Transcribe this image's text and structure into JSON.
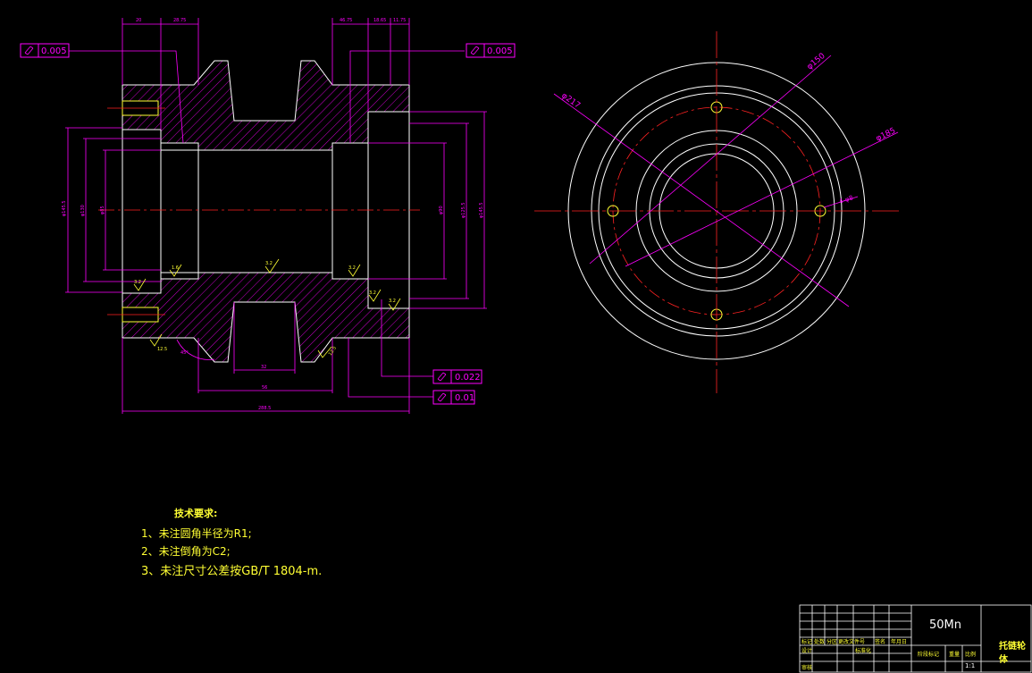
{
  "tolerances": {
    "top_left": "0.005",
    "top_right": "0.005",
    "bottom_1": "0.022",
    "bottom_2": "0.01"
  },
  "roughness": {
    "r1": "1.6",
    "r2": "3.2",
    "r3": "3.2",
    "r4": "3.2",
    "r5": "3.2",
    "r6": "3.2",
    "r7": "12.5",
    "r8": "12.5"
  },
  "dimensions_front": {
    "top_1": "20",
    "top_2": "28.75",
    "top_3": "46.75",
    "top_4": "18.65",
    "top_5": "11.75",
    "bottom_1": "32",
    "bottom_2": "56",
    "bottom_3": "288.5",
    "left_1": "φ145.5",
    "left_2": "φ130",
    "left_3": "φ85",
    "right_1": "φ90",
    "right_2": "φ125.5",
    "right_3": "φ145.5",
    "angle": "45°"
  },
  "dimensions_side": {
    "d1": "φ150",
    "d2": "φ217",
    "d3": "φ185",
    "hole": "4-φ8"
  },
  "tech_notes": {
    "title": "技术要求:",
    "n1": "1、未注圆角半径为R1;",
    "n2": "2、未注倒角为C2;",
    "n3": "3、未注尺寸公差按GB/T 1804-m."
  },
  "title_block": {
    "material": "50Mn",
    "part_name": "托链轮体",
    "scale": "1:1",
    "h_mark": "标记",
    "h_count": "处数",
    "h_zone": "分区",
    "h_doc": "更改文件号",
    "h_sign": "签名",
    "h_date": "年月日",
    "h_design": "设计",
    "h_std": "标准化",
    "h_stage": "阶段标记",
    "h_weight": "重量",
    "h_ratio": "比例",
    "h_audit": "审核"
  },
  "colors": {
    "outline": "#ffffff",
    "dimension": "#ff00ff",
    "centerline": "#ff2222",
    "text": "#ffff33",
    "hatch": "#ff00ff"
  }
}
